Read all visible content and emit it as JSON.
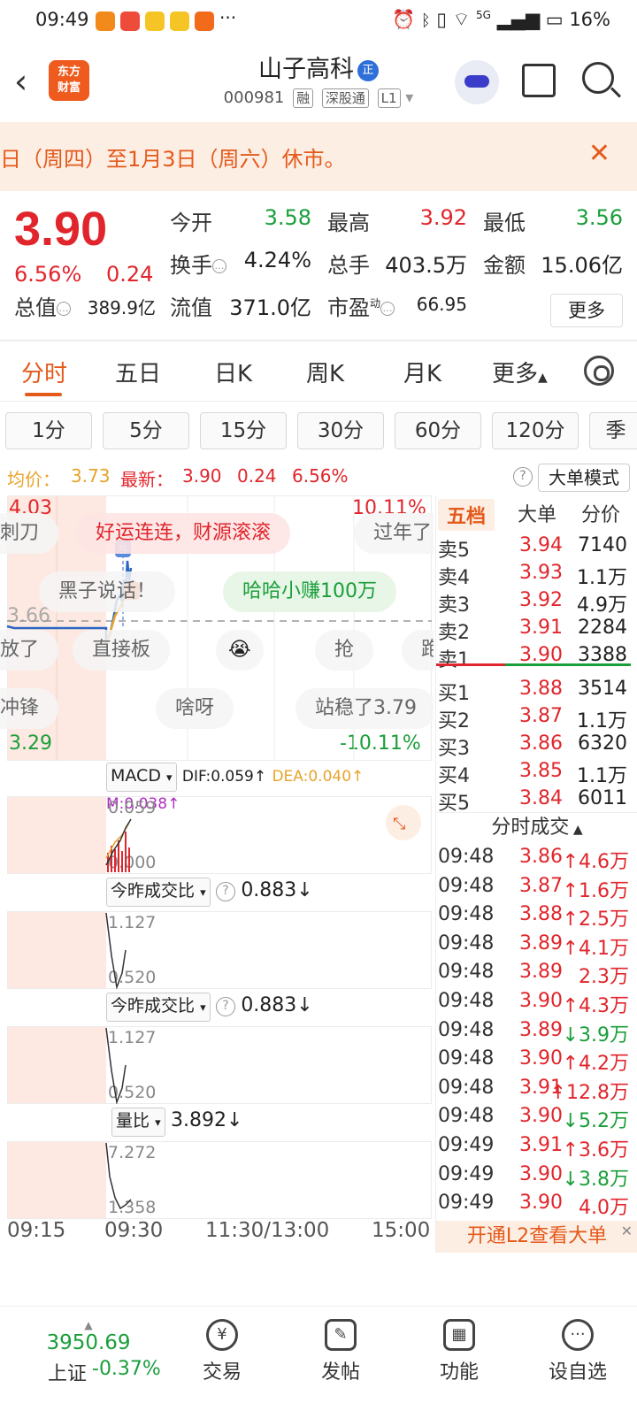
{
  "status": {
    "time": "09:49",
    "battery": "16%",
    "network": "5G"
  },
  "header": {
    "logo_line1": "东方",
    "logo_line2": "财富",
    "stock_name": "山子高科",
    "badge": "正",
    "code": "000981",
    "tags": [
      "融",
      "深股通",
      "L1"
    ]
  },
  "notice": {
    "text": "日（周四）至1月3日（周六）休市。"
  },
  "quote": {
    "price": "3.90",
    "change_pct": "6.56%",
    "change": "0.24",
    "open_label": "今开",
    "open": "3.58",
    "high_label": "最高",
    "high": "3.92",
    "low_label": "最低",
    "low": "3.56",
    "turnover_label": "换手",
    "turnover": "4.24%",
    "volume_label": "总手",
    "volume": "403.5万",
    "amount_label": "金额",
    "amount": "15.06亿",
    "mcap_label": "总值",
    "mcap": "389.9亿",
    "float_label": "流值",
    "float_cap": "371.0亿",
    "pe_label": "市盈",
    "pe_sup": "动",
    "pe": "66.95",
    "more": "更多"
  },
  "tabs": {
    "items": [
      "分时",
      "五日",
      "日K",
      "周K",
      "月K",
      "更多"
    ]
  },
  "periods": [
    "1分",
    "5分",
    "15分",
    "30分",
    "60分",
    "120分",
    "季"
  ],
  "avgline": {
    "avg_label": "均价：",
    "avg": "3.73",
    "latest_label": "最新：",
    "latest": "3.90",
    "chg": "0.24",
    "pct": "6.56%",
    "mode": "大单模式"
  },
  "chart": {
    "max_price": "4.03",
    "max_pct": "10.11%",
    "min_price": "3.29",
    "min_pct": "-10.11%",
    "mid_price": "3.66",
    "bubbles": [
      "刺刀",
      "好运连连，财源滚滚",
      "过年了",
      "黑子说话！",
      "哈哈小赚100万",
      "放了",
      "直接板",
      "抢",
      "跑",
      "冲锋",
      "啥呀",
      "站稳了3.79"
    ],
    "times": [
      "09:15",
      "09:30",
      "11:30/13:00",
      "15:00"
    ],
    "line_color": "#2b65c4",
    "avg_color": "#e8a32b"
  },
  "indicators": {
    "macd": {
      "name": "MACD",
      "dif": "DIF:0.059↑",
      "dea": "DEA:0.040↑",
      "m": "M:0.038↑",
      "top": "0.059",
      "bottom": "0.000"
    },
    "ratio1": {
      "name": "今昨成交比",
      "value": "0.883",
      "arrow": "↓",
      "top": "1.127",
      "bottom": "0.520"
    },
    "ratio2": {
      "name": "今昨成交比",
      "value": "0.883",
      "arrow": "↓",
      "top": "1.127",
      "bottom": "0.520"
    },
    "volratio": {
      "name": "量比",
      "value": "3.892",
      "arrow": "↓",
      "top": "7.272",
      "bottom": "1.358"
    }
  },
  "panel": {
    "tabs": [
      "五档",
      "大单",
      "分价"
    ],
    "asks": [
      {
        "label": "卖5",
        "price": "3.94",
        "vol": "7140"
      },
      {
        "label": "卖4",
        "price": "3.93",
        "vol": "1.1万"
      },
      {
        "label": "卖3",
        "price": "3.92",
        "vol": "4.9万"
      },
      {
        "label": "卖2",
        "price": "3.91",
        "vol": "2284"
      },
      {
        "label": "卖1",
        "price": "3.90",
        "vol": "3388"
      }
    ],
    "bids": [
      {
        "label": "买1",
        "price": "3.88",
        "vol": "3514"
      },
      {
        "label": "买2",
        "price": "3.87",
        "vol": "1.1万"
      },
      {
        "label": "买3",
        "price": "3.86",
        "vol": "6320"
      },
      {
        "label": "买4",
        "price": "3.85",
        "vol": "1.1万"
      },
      {
        "label": "买5",
        "price": "3.84",
        "vol": "6011"
      }
    ],
    "trades_title": "分时成交",
    "trades": [
      {
        "t": "09:48",
        "p": "3.86",
        "v": "↑4.6万",
        "c": "red"
      },
      {
        "t": "09:48",
        "p": "3.87",
        "v": "↑1.6万",
        "c": "red"
      },
      {
        "t": "09:48",
        "p": "3.88",
        "v": "↑2.5万",
        "c": "red"
      },
      {
        "t": "09:48",
        "p": "3.89",
        "v": "↑4.1万",
        "c": "red"
      },
      {
        "t": "09:48",
        "p": "3.89",
        "v": "2.3万",
        "c": "red"
      },
      {
        "t": "09:48",
        "p": "3.90",
        "v": "↑4.3万",
        "c": "red"
      },
      {
        "t": "09:48",
        "p": "3.89",
        "v": "↓3.9万",
        "c": "green"
      },
      {
        "t": "09:48",
        "p": "3.90",
        "v": "↑4.2万",
        "c": "red"
      },
      {
        "t": "09:48",
        "p": "3.91",
        "v": "↑12.8万",
        "c": "red"
      },
      {
        "t": "09:48",
        "p": "3.90",
        "v": "↓5.2万",
        "c": "green"
      },
      {
        "t": "09:49",
        "p": "3.91",
        "v": "↑3.6万",
        "c": "red"
      },
      {
        "t": "09:49",
        "p": "3.90",
        "v": "↓3.8万",
        "c": "green"
      },
      {
        "t": "09:49",
        "p": "3.90",
        "v": "4.0万",
        "c": "red"
      }
    ],
    "l2": "开通L2查看大单"
  },
  "bottom": {
    "index_value": "3950.69",
    "index_name": "上证",
    "index_change": "-0.37%",
    "nav": [
      "交易",
      "发帖",
      "功能",
      "设自选"
    ]
  }
}
